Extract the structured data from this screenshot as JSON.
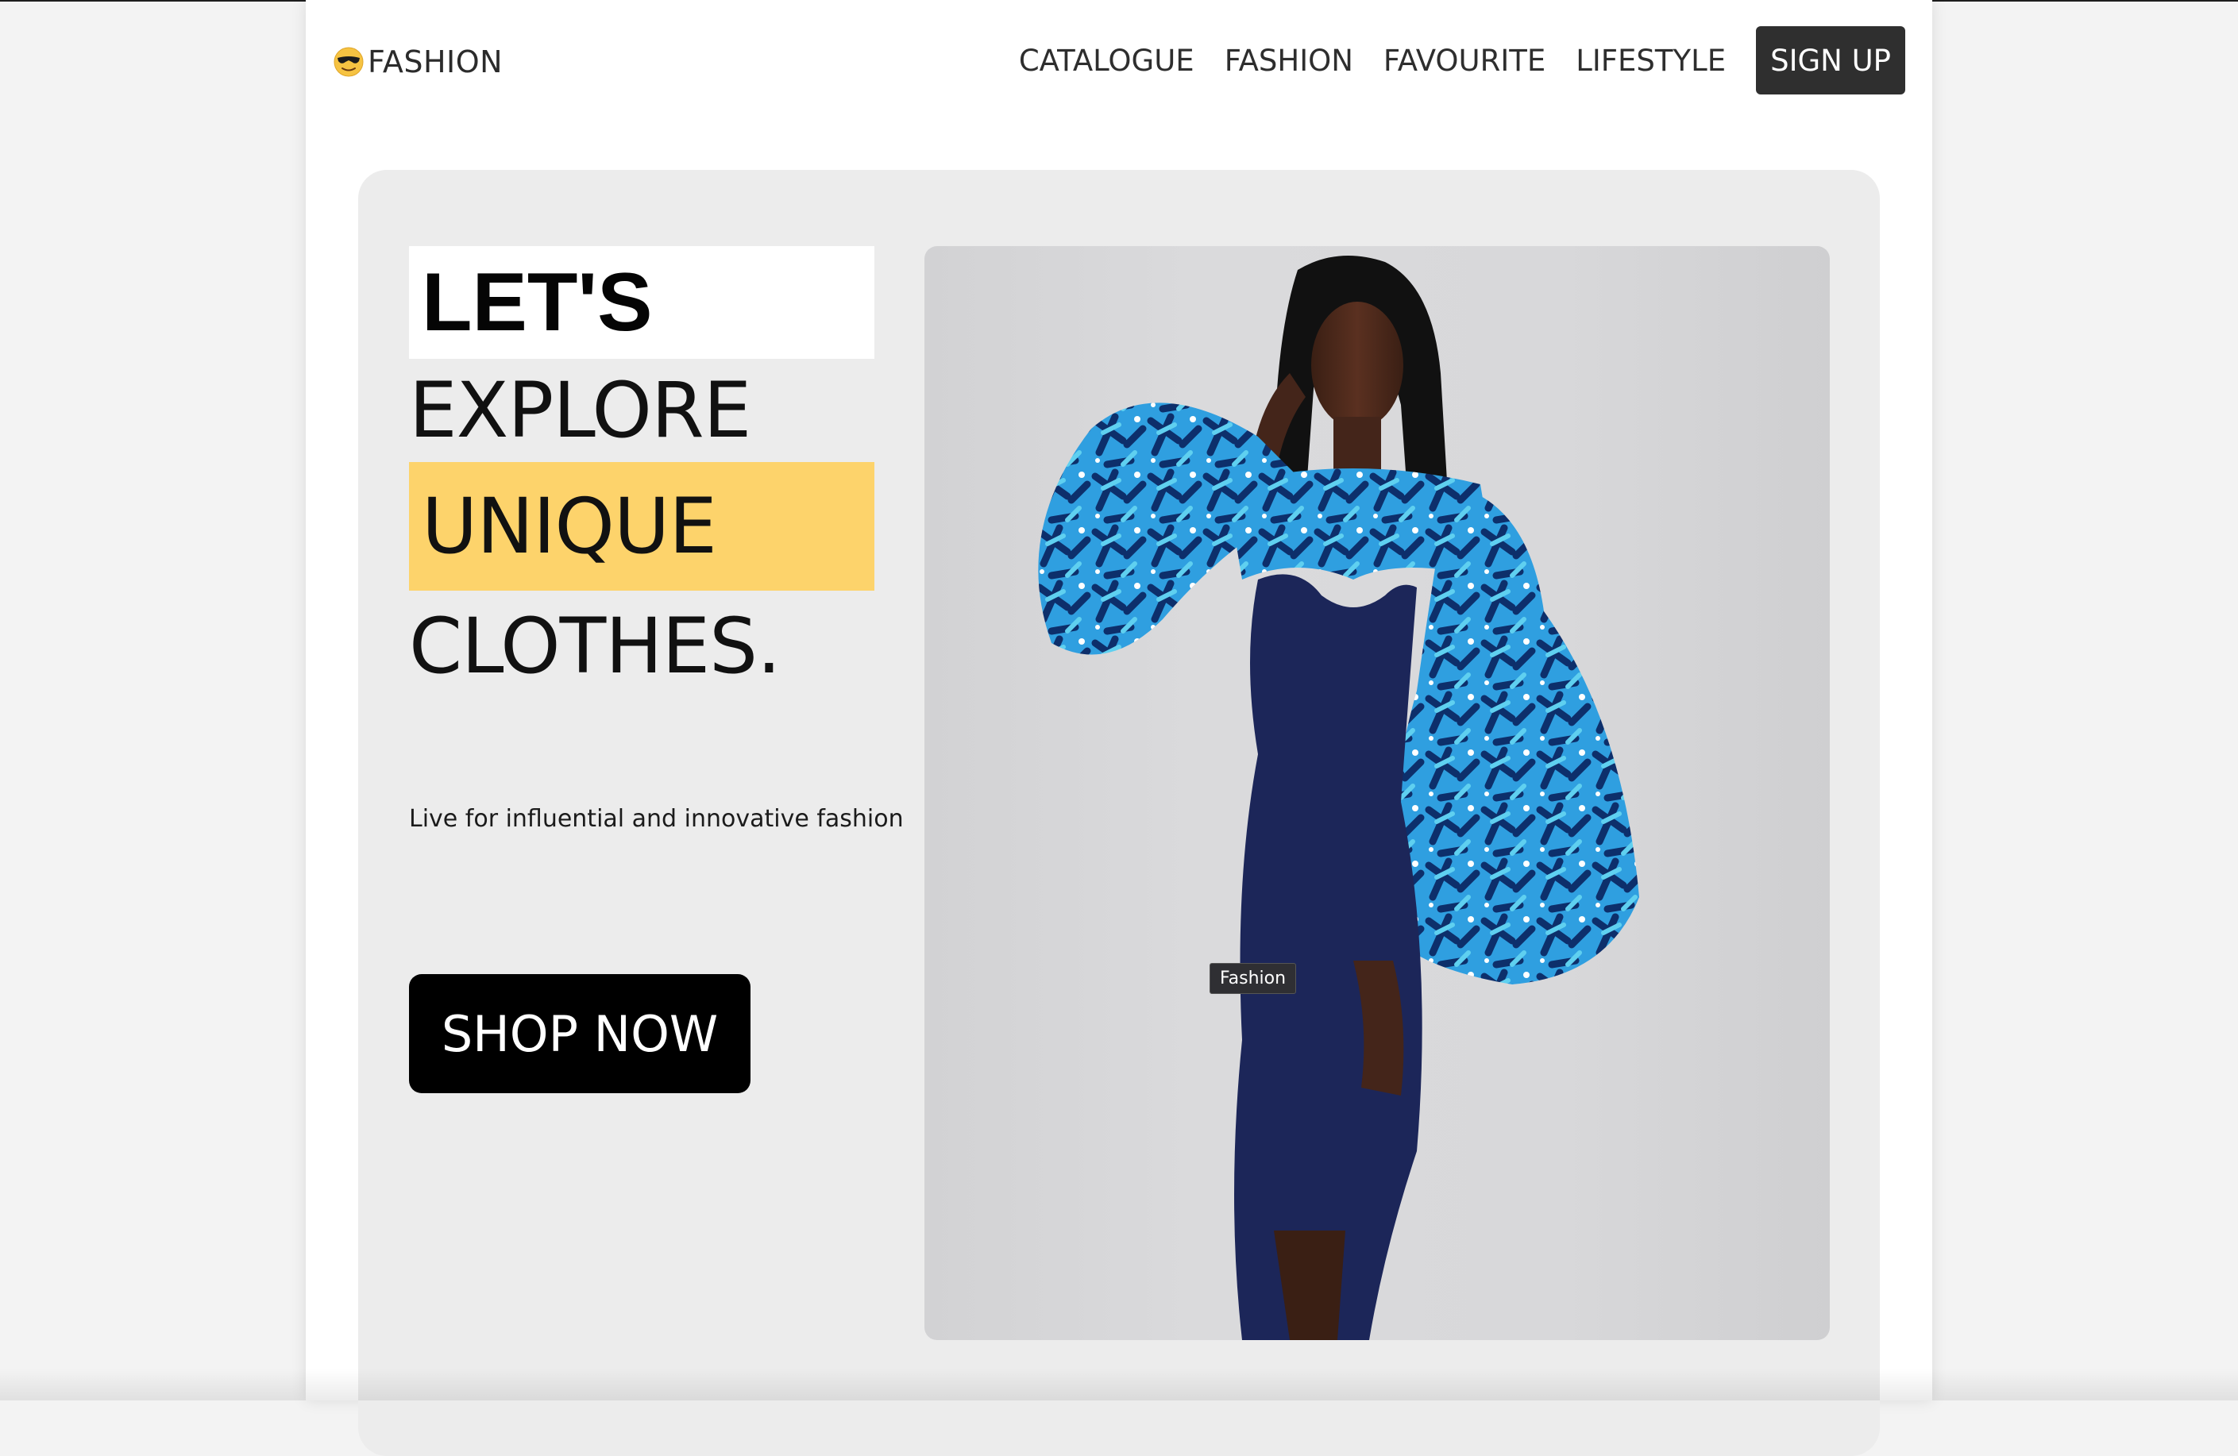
{
  "brand": {
    "icon": "sunglasses-face-icon",
    "name": "FASHION"
  },
  "nav": {
    "items": [
      {
        "label": "CATALOGUE"
      },
      {
        "label": "FASHION"
      },
      {
        "label": "FAVOURITE"
      },
      {
        "label": "LIFESTYLE"
      }
    ],
    "signup_label": "SIGN UP"
  },
  "hero": {
    "heading_lines": [
      "LET'S",
      "EXPLORE",
      "UNIQUE",
      "CLOTHES."
    ],
    "tagline": "Live for influential and innovative fashion",
    "cta_label": "SHOP NOW",
    "image_label": "Fashion",
    "highlight_color": "#fdd36b",
    "panel_color": "#ececec"
  }
}
